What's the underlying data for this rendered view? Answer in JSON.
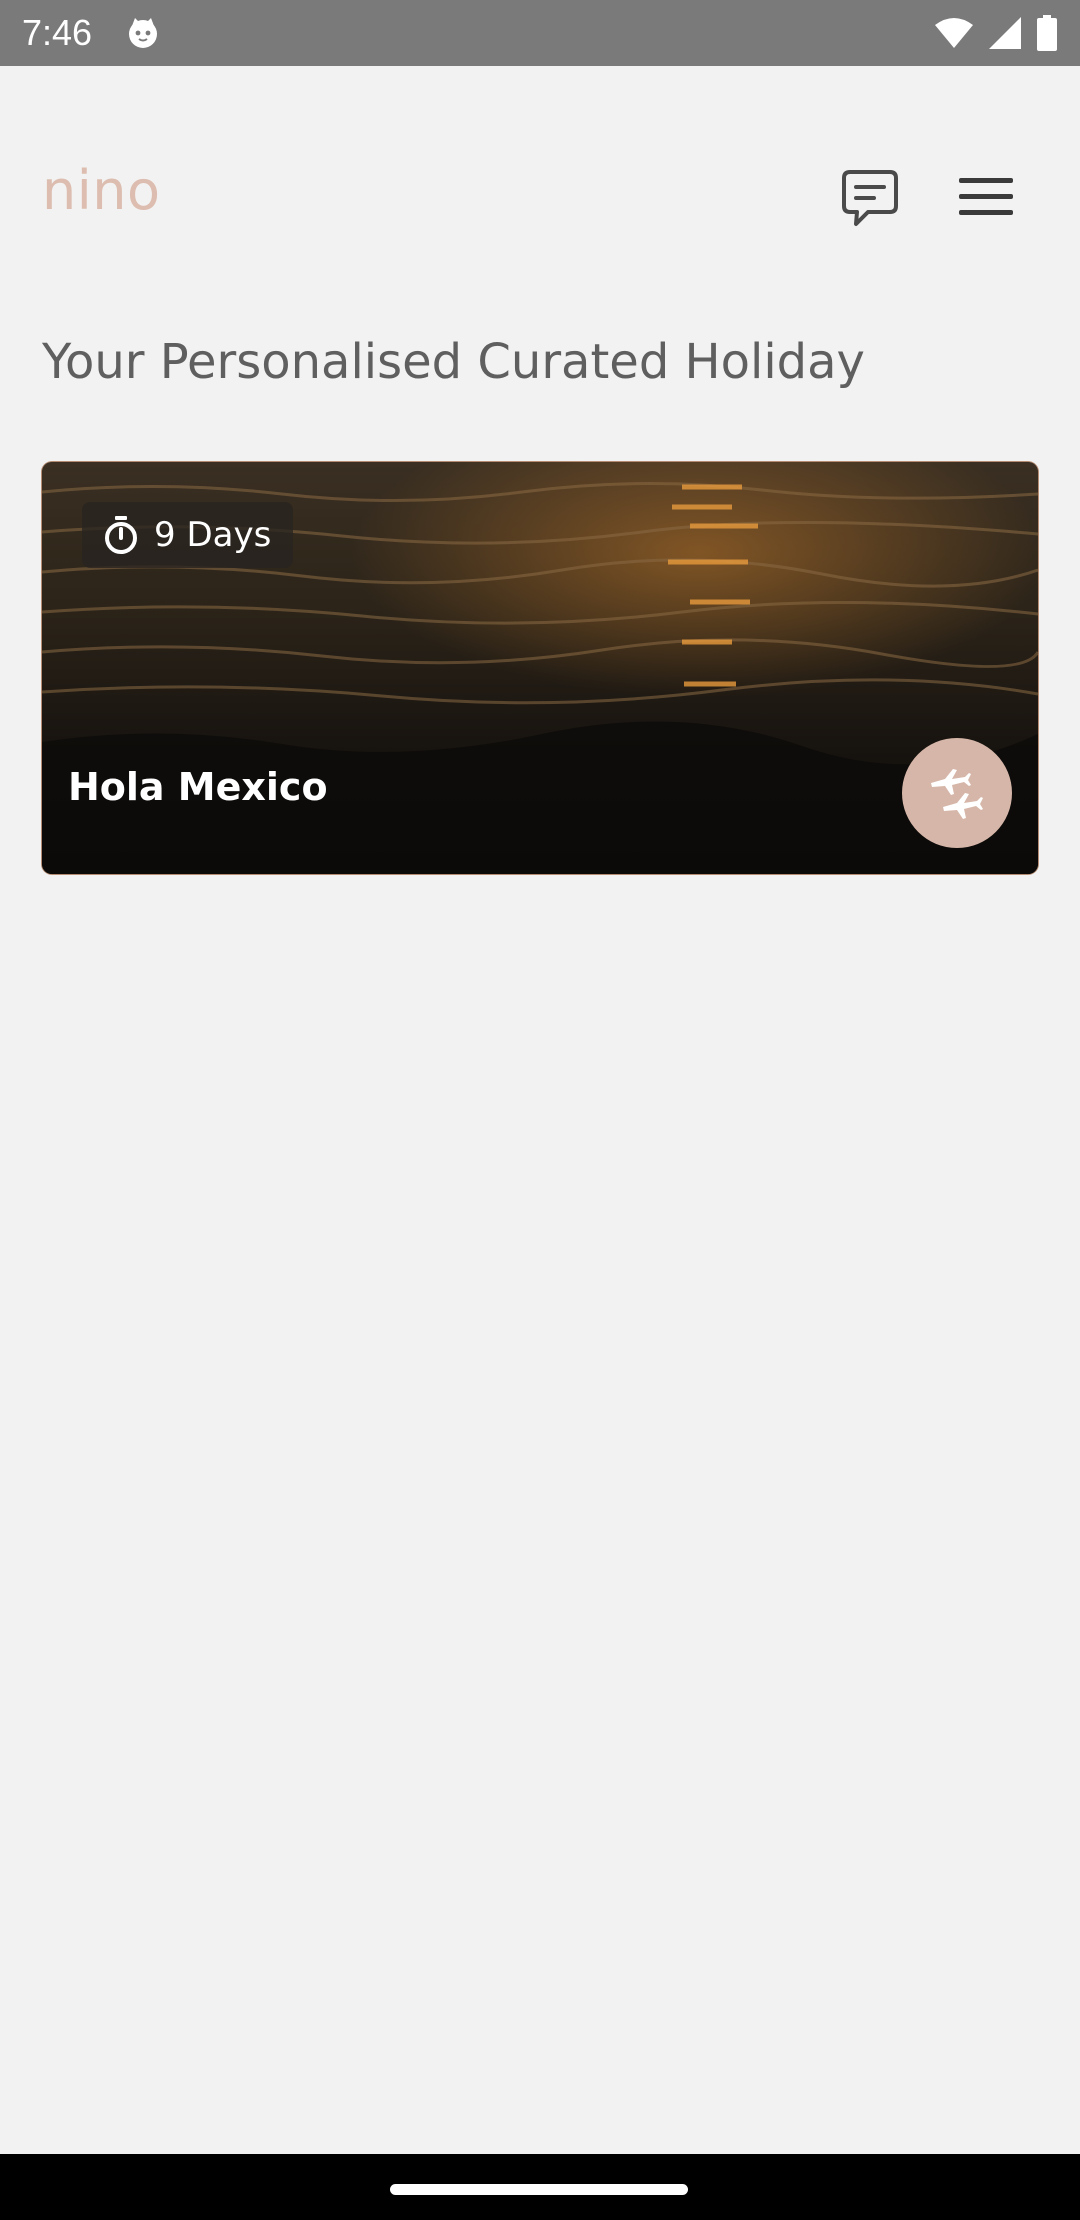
{
  "status_bar": {
    "time": "7:46",
    "icons": [
      "cat-app-icon",
      "wifi-icon",
      "cellular-icon",
      "battery-icon"
    ]
  },
  "header": {
    "logo": "nino",
    "logo_color": "#dcbdaf",
    "chat_icon": "chat-icon",
    "menu_icon": "hamburger-menu-icon"
  },
  "page": {
    "title": "Your Personalised Curated Holiday"
  },
  "trip_card": {
    "duration": "9 Days",
    "duration_icon": "stopwatch-icon",
    "title": "Hola Mexico",
    "image": "sunset-ocean-waves",
    "action_icon": "flights-icon",
    "action_color": "#d6b6a8"
  }
}
